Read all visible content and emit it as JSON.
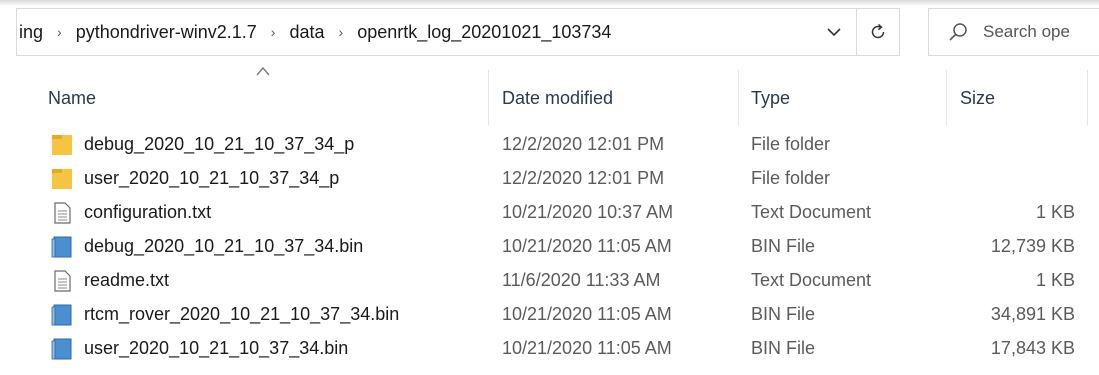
{
  "addressbar": {
    "crumbs": [
      "ing",
      "pythondriver-winv2.1.7",
      "data",
      "openrtk_log_20201021_103734"
    ],
    "separator": "›"
  },
  "search": {
    "placeholder": "Search ope"
  },
  "columns": {
    "name": "Name",
    "date": "Date modified",
    "type": "Type",
    "size": "Size"
  },
  "files": [
    {
      "name": "debug_2020_10_21_10_37_34_p",
      "date": "12/2/2020 12:01 PM",
      "type": "File folder",
      "size": "",
      "icon": "folder-icon"
    },
    {
      "name": "user_2020_10_21_10_37_34_p",
      "date": "12/2/2020 12:01 PM",
      "type": "File folder",
      "size": "",
      "icon": "folder-icon"
    },
    {
      "name": "configuration.txt",
      "date": "10/21/2020 10:37 AM",
      "type": "Text Document",
      "size": "1 KB",
      "icon": "text-file-icon"
    },
    {
      "name": "debug_2020_10_21_10_37_34.bin",
      "date": "10/21/2020 11:05 AM",
      "type": "BIN File",
      "size": "12,739 KB",
      "icon": "bin-file-icon"
    },
    {
      "name": "readme.txt",
      "date": "11/6/2020 11:33 AM",
      "type": "Text Document",
      "size": "1 KB",
      "icon": "text-file-icon"
    },
    {
      "name": "rtcm_rover_2020_10_21_10_37_34.bin",
      "date": "10/21/2020 11:05 AM",
      "type": "BIN File",
      "size": "34,891 KB",
      "icon": "bin-file-icon"
    },
    {
      "name": "user_2020_10_21_10_37_34.bin",
      "date": "10/21/2020 11:05 AM",
      "type": "BIN File",
      "size": "17,843 KB",
      "icon": "bin-file-icon"
    }
  ],
  "colors": {
    "folder": "#f5c542",
    "bin": "#4a8fd0",
    "header_text": "#2b3a4a"
  }
}
